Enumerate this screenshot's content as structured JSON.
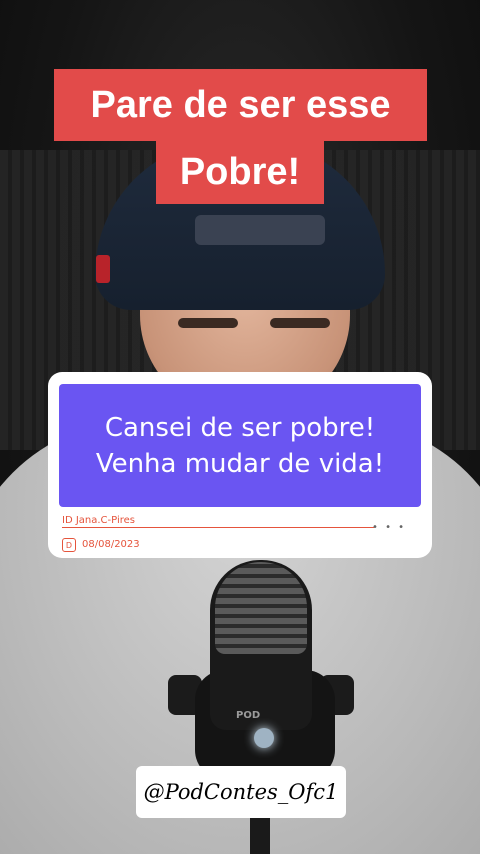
{
  "headline": {
    "line1": "Pare de ser esse",
    "line2": "Pobre!"
  },
  "card": {
    "line1": "Cansei de ser pobre!",
    "line2": "Venha mudar de vida!",
    "id_label": "ID  Jana.C-Pires",
    "more": "• • •",
    "date_icon": "D",
    "date": "08/08/2023"
  },
  "mic": {
    "brand": "POD"
  },
  "watermark": {
    "handle": "@PodContes_Ofc1"
  },
  "colors": {
    "headline_bg": "#e24b4a",
    "card_bg": "#6a55f2",
    "meta_accent": "#e5543c"
  }
}
